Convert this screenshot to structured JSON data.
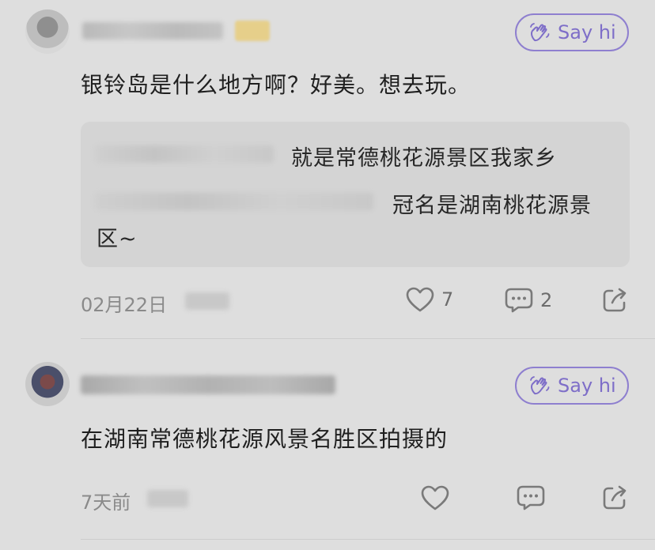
{
  "comments": [
    {
      "username": "",
      "say_hi": "Say hi",
      "text": "银铃岛是什么地方啊？好美。想去玩。",
      "replies": [
        {
          "author": "",
          "text": "就是常德桃花源景区我家乡"
        },
        {
          "author": "",
          "text_line1": "冠名是湖南桃花源景",
          "text_line2": "区~"
        }
      ],
      "date": "02月22日",
      "location": "",
      "likes": "7",
      "comments_count": "2"
    },
    {
      "username": "",
      "say_hi": "Say hi",
      "text": "在湖南常德桃花源风景名胜区拍摄的",
      "date": "7天前",
      "location": ""
    }
  ],
  "icons": {
    "like": "heart-icon",
    "comment": "comment-bubble-icon",
    "share": "share-arrow-icon",
    "wave": "waving-hand-icon"
  },
  "colors": {
    "background": "#dedede",
    "say_hi_accent": "#8e7fcf",
    "quote_bg": "#d4d4d4",
    "meta_text": "#8a8a8a"
  }
}
